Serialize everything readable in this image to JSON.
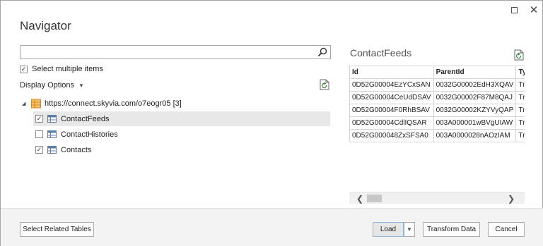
{
  "window": {
    "title": "Navigator"
  },
  "search": {
    "value": "",
    "placeholder": ""
  },
  "options": {
    "select_multiple_label": "Select multiple items",
    "select_multiple_checked": true,
    "display_options_label": "Display Options"
  },
  "tree": {
    "root_label": "https://connect.skyvia.com/o7eogr05 [3]",
    "items": [
      {
        "label": "ContactFeeds",
        "checked": true,
        "selected": true
      },
      {
        "label": "ContactHistories",
        "checked": false,
        "selected": false
      },
      {
        "label": "Contacts",
        "checked": true,
        "selected": false
      }
    ]
  },
  "preview": {
    "title": "ContactFeeds",
    "columns": [
      "Id",
      "ParentId",
      "Type"
    ],
    "rows": [
      [
        "0D52G00004EzYCxSAN",
        "0032G00002EdH3XQAV",
        "Trac"
      ],
      [
        "0D52G00004CeUdDSAV",
        "0032G00002F87M8QAJ",
        "Trac"
      ],
      [
        "0D52G00004F0RhBSAV",
        "0032G00002KZYVyQAP",
        "Trac"
      ],
      [
        "0D52G00004CdlIQSAR",
        "003A000001wBVgUIAW",
        "Trac"
      ],
      [
        "0D52G000048ZxSFSA0",
        "003A0000028nAOzIAM",
        "Trac"
      ]
    ]
  },
  "footer": {
    "select_related_label": "Select Related Tables",
    "load_label": "Load",
    "transform_label": "Transform Data",
    "cancel_label": "Cancel"
  },
  "colors": {
    "selected_row": "#e8e8e8",
    "folder_icon": "#e8a33d",
    "table_icon": "#5a7fa8"
  }
}
